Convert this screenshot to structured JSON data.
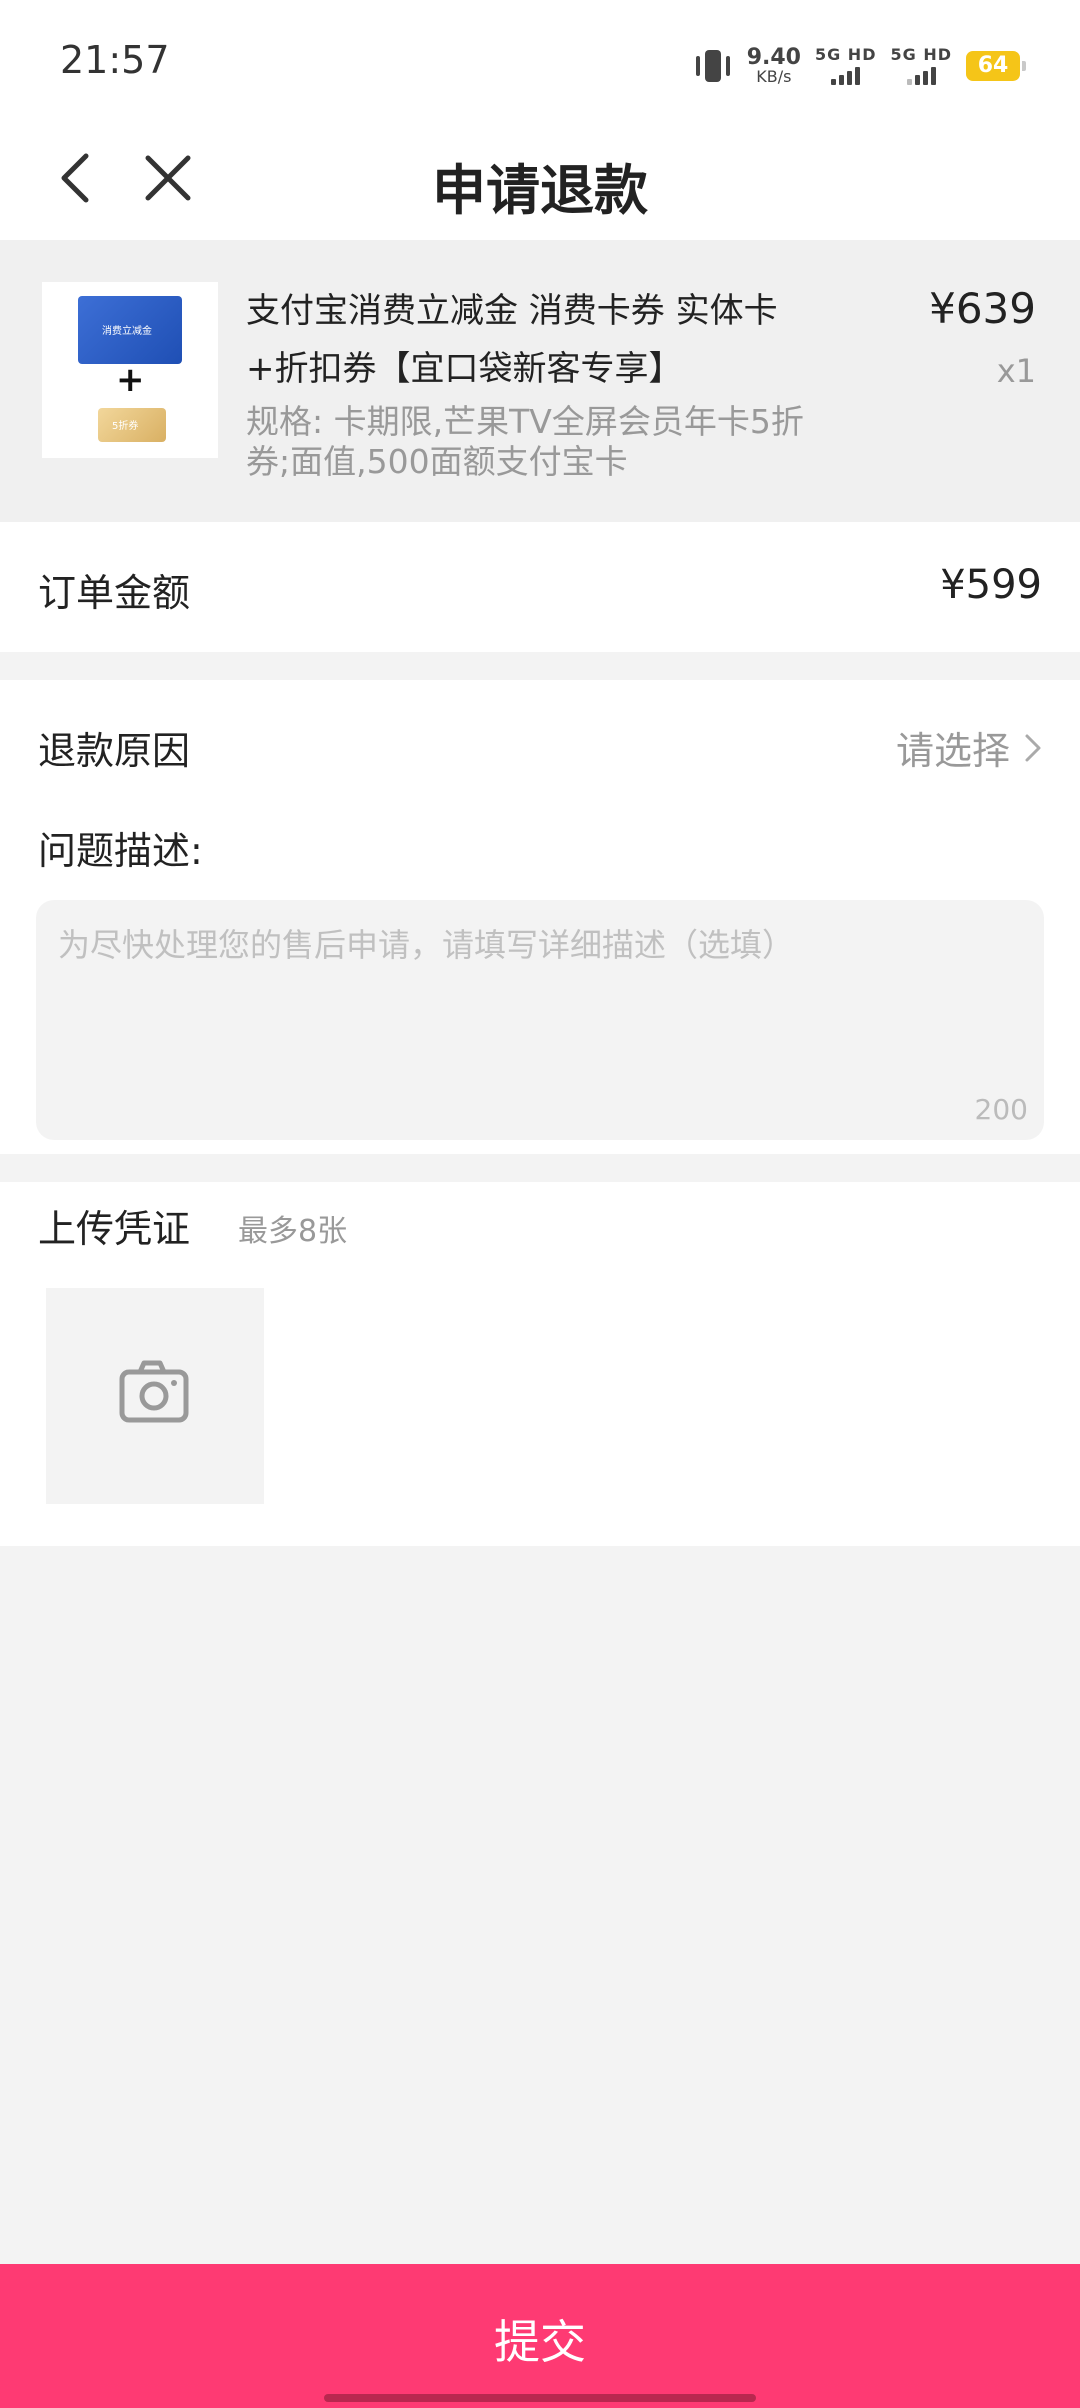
{
  "status_bar": {
    "time": "21:57",
    "net_speed_value": "9.40",
    "net_speed_unit": "KB/s",
    "signal1_label": "5G HD",
    "signal2_label": "5G HD",
    "battery": "64"
  },
  "header": {
    "title": "申请退款",
    "back_icon": "chevron-left",
    "close_icon": "x"
  },
  "product": {
    "name_line1": "支付宝消费立减金 消费卡券 实体卡",
    "name_line2": "+折扣券【宜口袋新客专享】",
    "spec_line1": "规格: 卡期限,芒果TV全屏会员年卡5折",
    "spec_line2": "券;面值,500面额支付宝卡",
    "price": "¥639",
    "quantity": "x1",
    "thumb_card_text": "消费立减金",
    "thumb_plus": "+",
    "thumb_coupon_text": "5折券"
  },
  "order": {
    "amount_label": "订单金额",
    "amount_value": "¥599"
  },
  "refund": {
    "reason_label": "退款原因",
    "reason_placeholder": "请选择",
    "description_label": "问题描述:",
    "description_placeholder": "为尽快处理您的售后申请，请填写详细描述（选填）",
    "description_limit": "200"
  },
  "upload": {
    "label": "上传凭证",
    "hint": "最多8张",
    "icon": "camera"
  },
  "submit_label": "提交",
  "colors": {
    "accent": "#fe3a73",
    "battery": "#f5c518",
    "muted_text": "#999999",
    "background": "#f3f3f3"
  }
}
